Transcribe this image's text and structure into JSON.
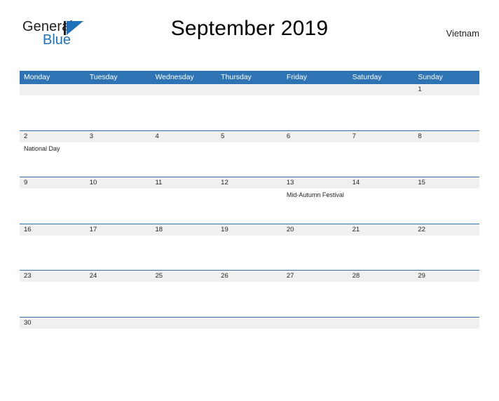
{
  "brand": {
    "name_part1": "General",
    "name_part2": "Blue",
    "logo_icon": "general-blue-triangle-logo",
    "accent_color": "#1f72b8"
  },
  "header": {
    "title": "September 2019",
    "country": "Vietnam"
  },
  "theme": {
    "header_blue": "#2e74b5",
    "row_divider_blue": "#2e74b5",
    "date_band_gray": "#f0f0f0",
    "text_color": "#231f20"
  },
  "calendar": {
    "month": "September",
    "year": "2019",
    "weekday_headers": [
      "Monday",
      "Tuesday",
      "Wednesday",
      "Thursday",
      "Friday",
      "Saturday",
      "Sunday"
    ],
    "weeks": [
      {
        "days": [
          {
            "number": "",
            "events": []
          },
          {
            "number": "",
            "events": []
          },
          {
            "number": "",
            "events": []
          },
          {
            "number": "",
            "events": []
          },
          {
            "number": "",
            "events": []
          },
          {
            "number": "",
            "events": []
          },
          {
            "number": "1",
            "events": []
          }
        ]
      },
      {
        "days": [
          {
            "number": "2",
            "events": [
              "National Day"
            ]
          },
          {
            "number": "3",
            "events": []
          },
          {
            "number": "4",
            "events": []
          },
          {
            "number": "5",
            "events": []
          },
          {
            "number": "6",
            "events": []
          },
          {
            "number": "7",
            "events": []
          },
          {
            "number": "8",
            "events": []
          }
        ]
      },
      {
        "days": [
          {
            "number": "9",
            "events": []
          },
          {
            "number": "10",
            "events": []
          },
          {
            "number": "11",
            "events": []
          },
          {
            "number": "12",
            "events": []
          },
          {
            "number": "13",
            "events": [
              "Mid-Autumn Festival"
            ]
          },
          {
            "number": "14",
            "events": []
          },
          {
            "number": "15",
            "events": []
          }
        ]
      },
      {
        "days": [
          {
            "number": "16",
            "events": []
          },
          {
            "number": "17",
            "events": []
          },
          {
            "number": "18",
            "events": []
          },
          {
            "number": "19",
            "events": []
          },
          {
            "number": "20",
            "events": []
          },
          {
            "number": "21",
            "events": []
          },
          {
            "number": "22",
            "events": []
          }
        ]
      },
      {
        "days": [
          {
            "number": "23",
            "events": []
          },
          {
            "number": "24",
            "events": []
          },
          {
            "number": "25",
            "events": []
          },
          {
            "number": "26",
            "events": []
          },
          {
            "number": "27",
            "events": []
          },
          {
            "number": "28",
            "events": []
          },
          {
            "number": "29",
            "events": []
          }
        ]
      },
      {
        "days": [
          {
            "number": "30",
            "events": []
          },
          {
            "number": "",
            "events": []
          },
          {
            "number": "",
            "events": []
          },
          {
            "number": "",
            "events": []
          },
          {
            "number": "",
            "events": []
          },
          {
            "number": "",
            "events": []
          },
          {
            "number": "",
            "events": []
          }
        ]
      }
    ]
  }
}
